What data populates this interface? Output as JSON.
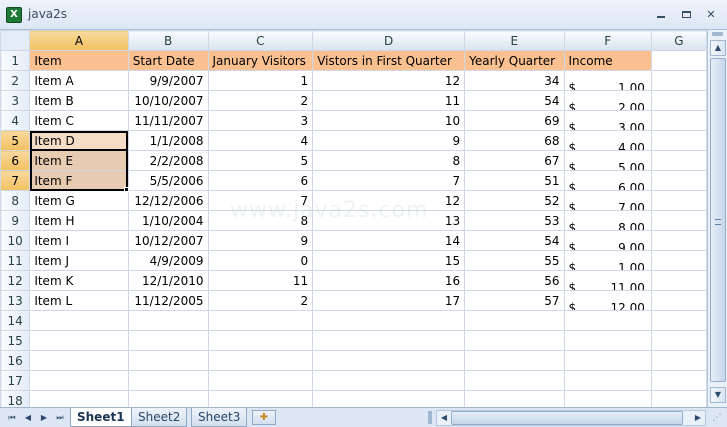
{
  "window": {
    "title": "java2s",
    "app_icon_letter": "X"
  },
  "grid": {
    "columns": [
      "A",
      "B",
      "C",
      "D",
      "E",
      "F",
      "G"
    ],
    "selected_columns": [
      "A"
    ],
    "selected_rows": [
      5,
      6,
      7
    ],
    "header_row": [
      "Item",
      "Start Date",
      "January Visitors",
      "Vistors in First Quarter",
      "Yearly Quarter",
      "Income"
    ],
    "rows": [
      {
        "num": "1"
      },
      {
        "num": "2",
        "item": "Item A",
        "start": "9/9/2007",
        "jan": "1",
        "q1": "12",
        "yearly": "34",
        "cur": "$",
        "income": "1.00"
      },
      {
        "num": "3",
        "item": "Item B",
        "start": "10/10/2007",
        "jan": "2",
        "q1": "11",
        "yearly": "54",
        "cur": "$",
        "income": "2.00"
      },
      {
        "num": "4",
        "item": "Item C",
        "start": "11/11/2007",
        "jan": "3",
        "q1": "10",
        "yearly": "69",
        "cur": "$",
        "income": "3.00"
      },
      {
        "num": "5",
        "item": "Item D",
        "start": "1/1/2008",
        "jan": "4",
        "q1": "9",
        "yearly": "68",
        "cur": "$",
        "income": "4.00"
      },
      {
        "num": "6",
        "item": "Item E",
        "start": "2/2/2008",
        "jan": "5",
        "q1": "8",
        "yearly": "67",
        "cur": "$",
        "income": "5.00"
      },
      {
        "num": "7",
        "item": "Item F",
        "start": "5/5/2006",
        "jan": "6",
        "q1": "7",
        "yearly": "51",
        "cur": "$",
        "income": "6.00"
      },
      {
        "num": "8",
        "item": "Item G",
        "start": "12/12/2006",
        "jan": "7",
        "q1": "12",
        "yearly": "52",
        "cur": "$",
        "income": "7.00"
      },
      {
        "num": "9",
        "item": "Item H",
        "start": "1/10/2004",
        "jan": "8",
        "q1": "13",
        "yearly": "53",
        "cur": "$",
        "income": "8.00"
      },
      {
        "num": "10",
        "item": "Item I",
        "start": "10/12/2007",
        "jan": "9",
        "q1": "14",
        "yearly": "54",
        "cur": "$",
        "income": "9.00"
      },
      {
        "num": "11",
        "item": "Item J",
        "start": "4/9/2009",
        "jan": "0",
        "q1": "15",
        "yearly": "55",
        "cur": "$",
        "income": "1.00"
      },
      {
        "num": "12",
        "item": "Item K",
        "start": "12/1/2010",
        "jan": "11",
        "q1": "16",
        "yearly": "56",
        "cur": "$",
        "income": "11.00"
      },
      {
        "num": "13",
        "item": "Item L",
        "start": "11/12/2005",
        "jan": "2",
        "q1": "17",
        "yearly": "57",
        "cur": "$",
        "income": "12.00"
      },
      {
        "num": "14"
      },
      {
        "num": "15"
      },
      {
        "num": "16"
      },
      {
        "num": "17"
      },
      {
        "num": "18"
      }
    ],
    "header_fill_color": "#fac090",
    "selection_fill_color": "#e8ccb2"
  },
  "watermark": "www.java2s.com",
  "sheet_tabs": [
    {
      "label": "Sheet1",
      "active": true
    },
    {
      "label": "Sheet2",
      "active": false
    },
    {
      "label": "Sheet3",
      "active": false
    }
  ]
}
